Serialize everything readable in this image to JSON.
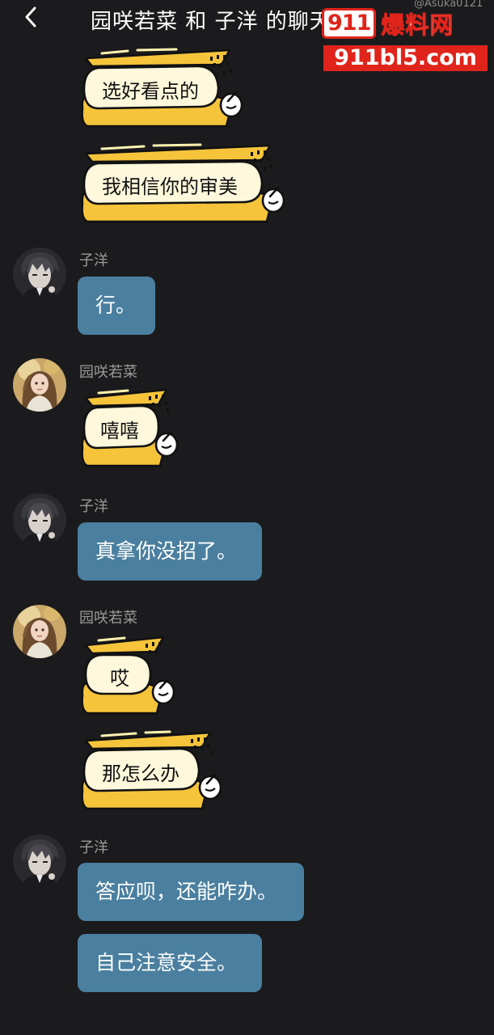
{
  "header": {
    "back_icon": "chevron-left-icon",
    "title": "园咲若菜 和 子洋 的聊天记录",
    "handle": "@Asuka0121"
  },
  "watermark": {
    "logo_box": "911",
    "logo_text": "爆料网",
    "url": "911bl5.com",
    "color": "#e0241b"
  },
  "users": {
    "ziyang": "子洋",
    "yuansaki": "园咲若菜"
  },
  "messages": {
    "m1": "选好看点的",
    "m2": "我相信你的审美",
    "m3": "行。",
    "m4": "嘻嘻",
    "m5": "真拿你没招了。",
    "m6": "哎",
    "m7": "那怎么办",
    "m8": "答应呗，还能咋办。",
    "m9": "自己注意安全。"
  },
  "colors": {
    "background": "#1b1b1d",
    "blue_bubble": "#4a7fa0",
    "sticker_yellow": "#f5c43b",
    "sticker_face": "#fff8dc"
  }
}
